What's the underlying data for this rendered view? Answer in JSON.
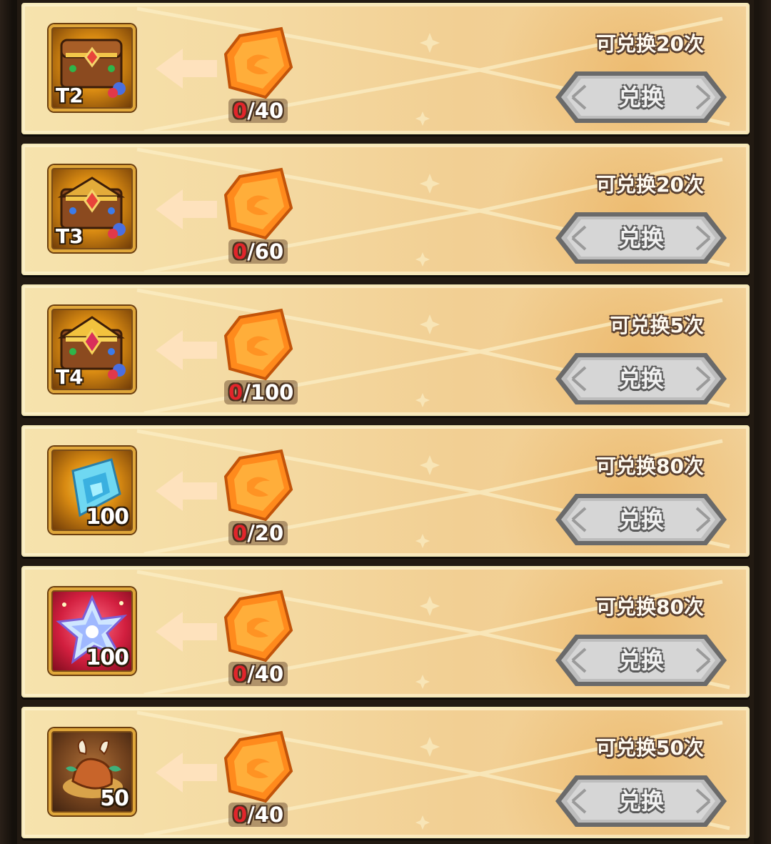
{
  "exchange_rows": [
    {
      "item": "treasure-chest-t2",
      "item_badge": "T2",
      "cost_owned": "0",
      "cost_required": "/40",
      "limit_text": "可兑换20次",
      "button_label": "兑换"
    },
    {
      "item": "treasure-chest-t3",
      "item_badge": "T3",
      "cost_owned": "0",
      "cost_required": "/60",
      "limit_text": "可兑换20次",
      "button_label": "兑换"
    },
    {
      "item": "treasure-chest-t4",
      "item_badge": "T4",
      "cost_owned": "0",
      "cost_required": "/100",
      "limit_text": "可兑换5次",
      "button_label": "兑换"
    },
    {
      "item": "blue-crystal",
      "item_badge": "100",
      "cost_owned": "0",
      "cost_required": "/20",
      "limit_text": "可兑换80次",
      "button_label": "兑换"
    },
    {
      "item": "prismatic-star",
      "item_badge": "100",
      "cost_owned": "0",
      "cost_required": "/40",
      "limit_text": "可兑换80次",
      "button_label": "兑换"
    },
    {
      "item": "roasted-meat",
      "item_badge": "50",
      "cost_owned": "0",
      "cost_required": "/40",
      "limit_text": "可兑换50次",
      "button_label": "兑换"
    }
  ],
  "icons": {
    "arrow": "arrow-left-icon",
    "currency": "orange-gem-icon"
  },
  "colors": {
    "owned_count": "#e2252b",
    "button": "#a9a9a9",
    "row_background": "#f4d9a1"
  }
}
